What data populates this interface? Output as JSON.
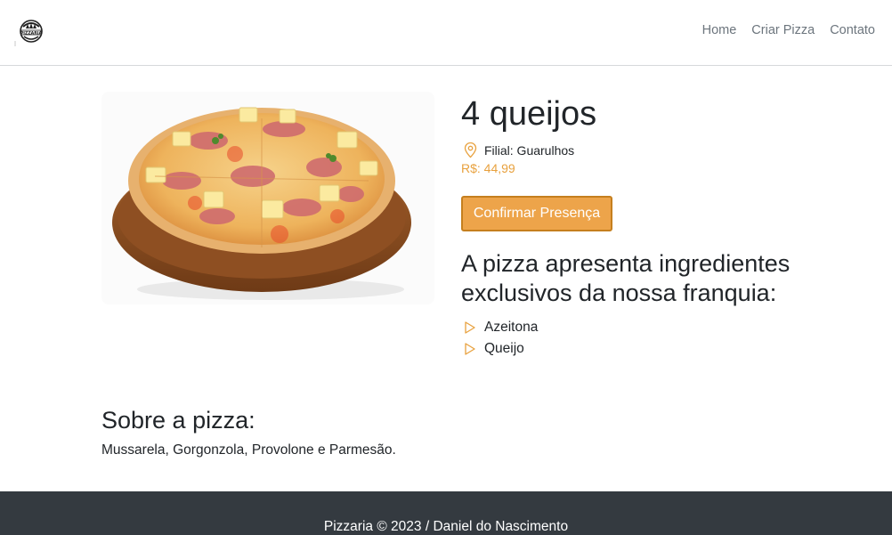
{
  "nav": {
    "logo_text": "PIZZARIA",
    "links": [
      "Home",
      "Criar Pizza",
      "Contato"
    ]
  },
  "pizza": {
    "title": "4 queijos",
    "branch": "Filial: Guarulhos",
    "price": "R$: 44,99",
    "confirm_label": "Confirmar Presença",
    "ingredients_heading": "A pizza apresenta ingredientes exclusivos da nossa franquia:",
    "ingredients": [
      "Azeitona",
      "Queijo"
    ],
    "image_alt": "Pizza 4 queijos"
  },
  "about": {
    "heading": "Sobre a pizza:",
    "text": "Mussarela, Gorgonzola, Provolone e Parmesão."
  },
  "footer": {
    "text": "Pizzaria © 2023 / Daniel do Nascimento"
  },
  "colors": {
    "accent": "#eda44a",
    "accent_border": "#c57f1e",
    "price": "#e8a13e",
    "footer_bg": "#343a40"
  },
  "icons": {
    "location": "map-pin-icon",
    "bullet": "triangle-right-icon"
  }
}
